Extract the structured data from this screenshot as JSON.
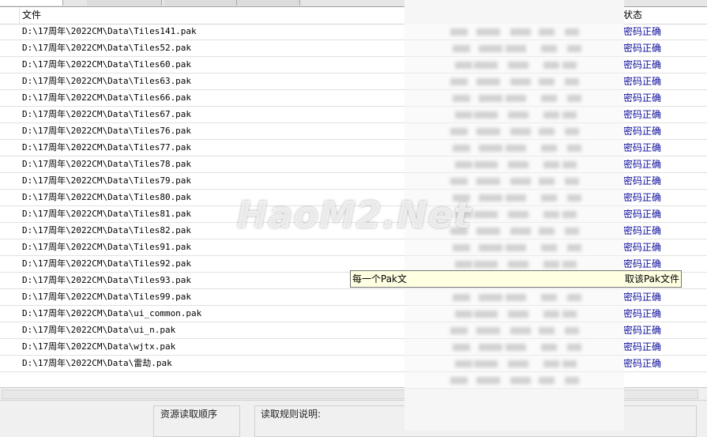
{
  "list": {
    "columns": {
      "file": "文件",
      "status": "状态"
    },
    "rows": [
      {
        "file": "D:\\17周年\\2022CM\\Data\\Tiles141.pak",
        "status": "密码正确"
      },
      {
        "file": "D:\\17周年\\2022CM\\Data\\Tiles52.pak",
        "status": "密码正确"
      },
      {
        "file": "D:\\17周年\\2022CM\\Data\\Tiles60.pak",
        "status": "密码正确"
      },
      {
        "file": "D:\\17周年\\2022CM\\Data\\Tiles63.pak",
        "status": "密码正确"
      },
      {
        "file": "D:\\17周年\\2022CM\\Data\\Tiles66.pak",
        "status": "密码正确"
      },
      {
        "file": "D:\\17周年\\2022CM\\Data\\Tiles67.pak",
        "status": "密码正确"
      },
      {
        "file": "D:\\17周年\\2022CM\\Data\\Tiles76.pak",
        "status": "密码正确"
      },
      {
        "file": "D:\\17周年\\2022CM\\Data\\Tiles77.pak",
        "status": "密码正确"
      },
      {
        "file": "D:\\17周年\\2022CM\\Data\\Tiles78.pak",
        "status": "密码正确"
      },
      {
        "file": "D:\\17周年\\2022CM\\Data\\Tiles79.pak",
        "status": "密码正确"
      },
      {
        "file": "D:\\17周年\\2022CM\\Data\\Tiles80.pak",
        "status": "密码正确"
      },
      {
        "file": "D:\\17周年\\2022CM\\Data\\Tiles81.pak",
        "status": "密码正确"
      },
      {
        "file": "D:\\17周年\\2022CM\\Data\\Tiles82.pak",
        "status": "密码正确"
      },
      {
        "file": "D:\\17周年\\2022CM\\Data\\Tiles91.pak",
        "status": "密码正确"
      },
      {
        "file": "D:\\17周年\\2022CM\\Data\\Tiles92.pak",
        "status": "密码正确"
      },
      {
        "file": "D:\\17周年\\2022CM\\Data\\Tiles93.pak",
        "status": ""
      },
      {
        "file": "D:\\17周年\\2022CM\\Data\\Tiles99.pak",
        "status": "密码正确"
      },
      {
        "file": "D:\\17周年\\2022CM\\Data\\ui_common.pak",
        "status": "密码正确"
      },
      {
        "file": "D:\\17周年\\2022CM\\Data\\ui_n.pak",
        "status": "密码正确"
      },
      {
        "file": "D:\\17周年\\2022CM\\Data\\wjtx.pak",
        "status": "密码正确"
      },
      {
        "file": "D:\\17周年\\2022CM\\Data\\雷劫.pak",
        "status": "密码正确"
      }
    ]
  },
  "tooltip": {
    "left_text": "每一个Pak文",
    "right_text": "取该Pak文件"
  },
  "bottom": {
    "load_order_label": "资源读取顺序",
    "rules_label": "读取规则说明:"
  },
  "watermark": "HaoM2.Net",
  "colors": {
    "status_text": "#0b0b9a",
    "tooltip_bg": "#ffffe1"
  }
}
